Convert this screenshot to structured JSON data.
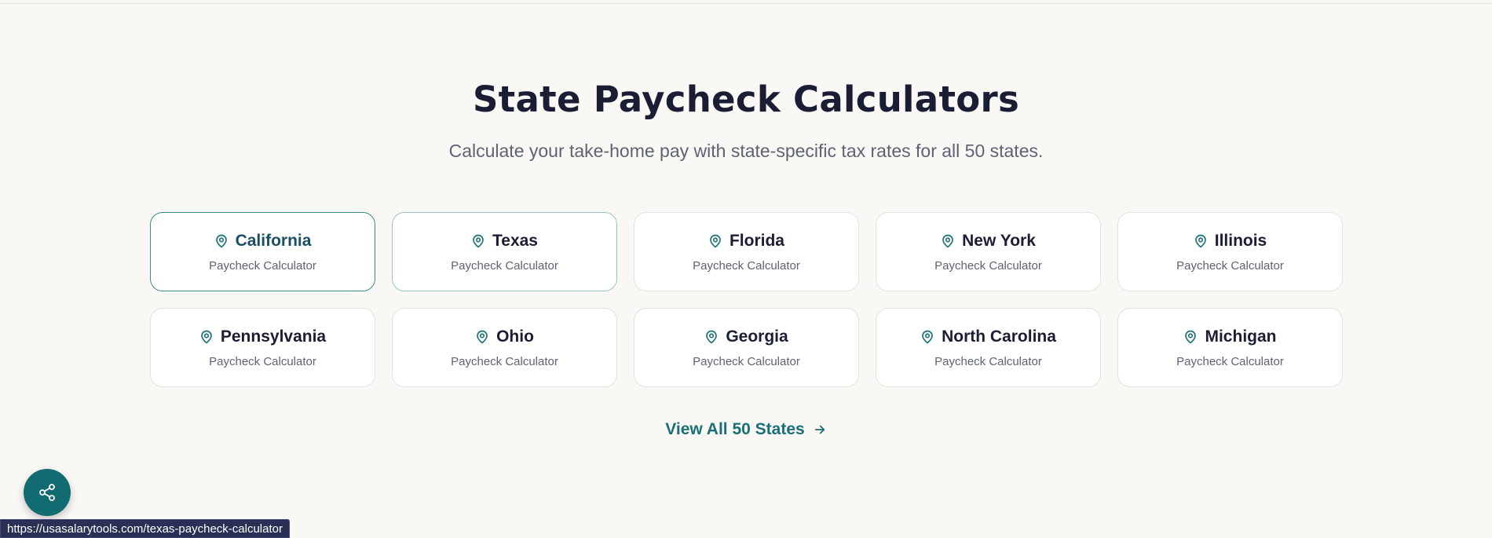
{
  "section": {
    "title": "State Paycheck Calculators",
    "subtitle": "Calculate your take-home pay with state-specific tax rates for all 50 states."
  },
  "states": [
    {
      "name": "California",
      "sub": "Paycheck Calculator"
    },
    {
      "name": "Texas",
      "sub": "Paycheck Calculator"
    },
    {
      "name": "Florida",
      "sub": "Paycheck Calculator"
    },
    {
      "name": "New York",
      "sub": "Paycheck Calculator"
    },
    {
      "name": "Illinois",
      "sub": "Paycheck Calculator"
    },
    {
      "name": "Pennsylvania",
      "sub": "Paycheck Calculator"
    },
    {
      "name": "Ohio",
      "sub": "Paycheck Calculator"
    },
    {
      "name": "Georgia",
      "sub": "Paycheck Calculator"
    },
    {
      "name": "North Carolina",
      "sub": "Paycheck Calculator"
    },
    {
      "name": "Michigan",
      "sub": "Paycheck Calculator"
    }
  ],
  "view_all": {
    "label": "View All 50 States",
    "icon": "arrow-right-icon"
  },
  "share": {
    "icon": "share-icon"
  },
  "status_bar": {
    "url": "https://usasalarytools.com/texas-paycheck-calculator"
  },
  "colors": {
    "accent": "#1b6f76",
    "share_button": "#126b70",
    "background": "#f9f8f5",
    "heading": "#1b1d35"
  }
}
